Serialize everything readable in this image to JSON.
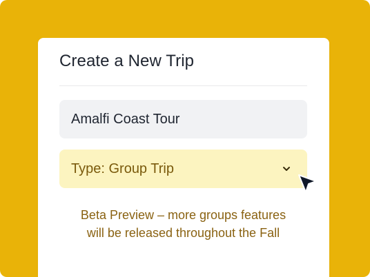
{
  "colors": {
    "background": "#e9b308",
    "card": "#ffffff",
    "input_bg": "#f1f2f4",
    "select_bg": "#fcf4c0",
    "select_text": "#7a5a0c",
    "note_text": "#8a6212"
  },
  "card": {
    "title": "Create a New Trip",
    "trip_name": {
      "value": "Amalfi Coast Tour"
    },
    "trip_type": {
      "selected": "Type: Group Trip",
      "icon": "chevron-down-icon"
    },
    "note": {
      "line1": "Beta Preview – more groups features",
      "line2": "will be released throughout the Fall"
    }
  },
  "cursor": {
    "icon": "mouse-pointer-icon"
  }
}
